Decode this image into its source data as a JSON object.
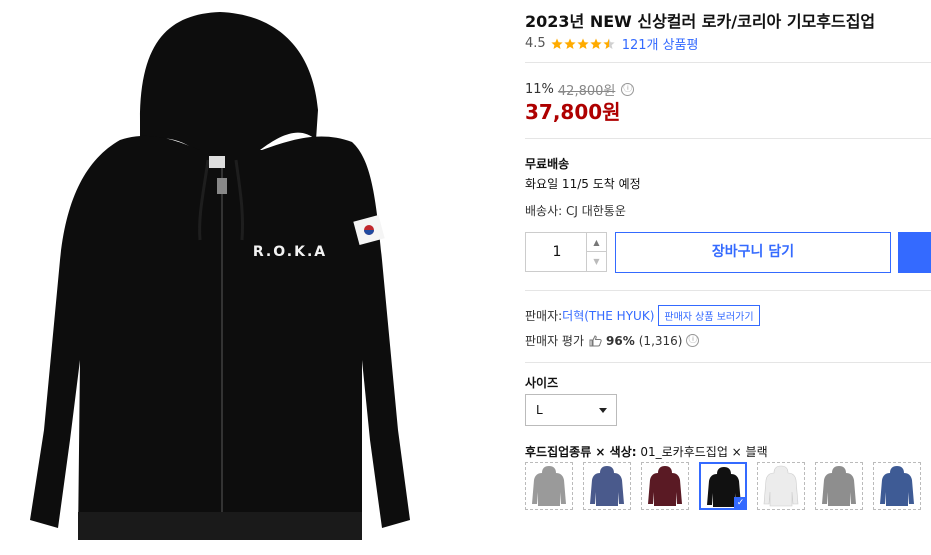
{
  "product": {
    "title": "2023년 NEW 신상컬러 로카/코리아 기모후드집업",
    "rating": "4.5",
    "review_count": "121개 상품평",
    "stars_filled": 4.5,
    "image": {
      "chest_print": "R.O.K.A",
      "garment_color": "#0d0d0d"
    }
  },
  "price": {
    "discount_rate": "11%",
    "original": "42,800원",
    "info_icon": "ⓘ",
    "sale": "37,800원",
    "sale_color": "#ae0000"
  },
  "shipping": {
    "label": "무료배송",
    "arrival": "화요일 11/5 도착 예정",
    "carrier": "배송사: CJ 대한통운"
  },
  "quantity": {
    "value": "1",
    "up_icon": "chevron-up-icon",
    "down_icon": "chevron-down-icon"
  },
  "buttons": {
    "cart": "장바구니 담기",
    "accent": "#346aff"
  },
  "seller": {
    "label": "판매자: ",
    "name": "더혁(THE HYUK)",
    "link": "판매자 상품 보러가기",
    "rating_label": "판매자 평가",
    "rating_pct": "96%",
    "rating_count": "(1,316)"
  },
  "size": {
    "label": "사이즈",
    "selected": "L"
  },
  "option": {
    "label_bold": "후드집업종류 × 색상:",
    "label_value": " 01_로카후드집업 × 블랙",
    "swatch_colors": [
      "#9a9a9a",
      "#4a5a8c",
      "#5a1a24",
      "#111111",
      "#ececec",
      "#8e8e8e",
      "#3e5b95"
    ],
    "selected_index": 3
  }
}
